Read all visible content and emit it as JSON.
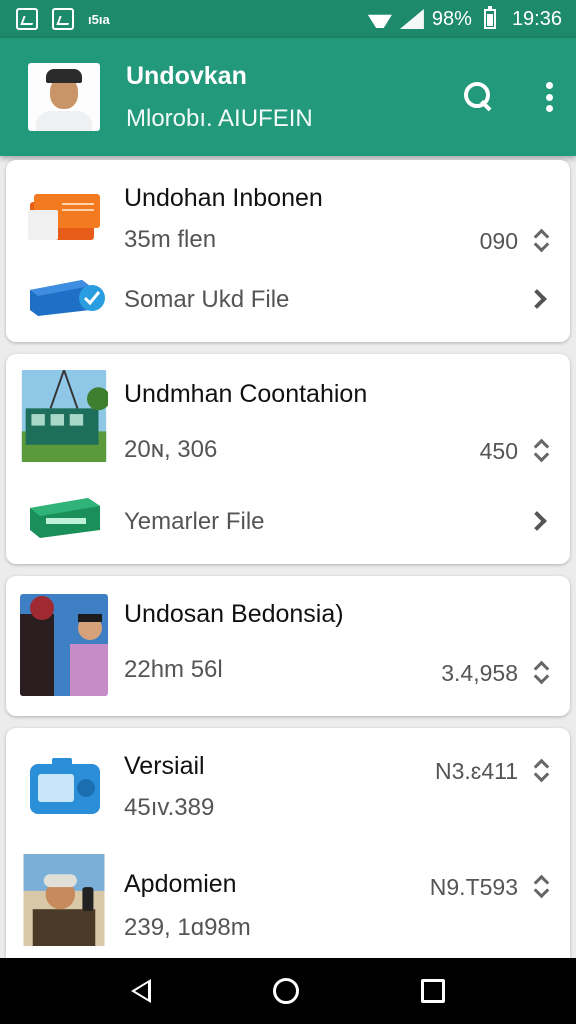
{
  "status_bar": {
    "left_text": "ı5ıa",
    "battery": "98%",
    "time": "19:36",
    "icons": [
      "image-icon",
      "image-icon",
      "wifi-icon",
      "signal-icon",
      "battery-icon"
    ]
  },
  "app_bar": {
    "title": "Undovkan",
    "subtitle": "Mlorobı. AIUFEIN",
    "actions": [
      "search-icon",
      "more-vert-icon"
    ]
  },
  "cards": [
    {
      "rows": [
        {
          "title": "Undohan Inbonen",
          "sub": "35m flen",
          "count": "090",
          "icon": "orange-folder-icon"
        },
        {
          "sub": "Somar Ukd File",
          "icon": "blue-box-check-icon"
        }
      ]
    },
    {
      "rows": [
        {
          "title": "Undmhan Coontahion",
          "sub": "20ɴ, 306",
          "count": "450",
          "icon": "train-photo"
        },
        {
          "sub": "Yemarler File",
          "icon": "green-box-icon"
        }
      ]
    },
    {
      "rows": [
        {
          "title": "Undosan Bedonsia)",
          "sub": "22hm 56l",
          "count": "3.4,958",
          "icon": "people-photo"
        }
      ]
    },
    {
      "rows": [
        {
          "title": "Versiail",
          "sub": "45ıv.389",
          "count": "N3.ɛ411",
          "icon": "blue-device-icon"
        },
        {
          "title": "Apdomien",
          "sub": "239, 1ɑ98m",
          "count": "N9.T593",
          "icon": "person-photo"
        }
      ]
    }
  ],
  "nav_bar": [
    "back-icon",
    "home-icon",
    "recents-icon"
  ],
  "colors": {
    "status_bar": "#1e8a6c",
    "app_bar": "#22997a",
    "background": "#ececec"
  }
}
